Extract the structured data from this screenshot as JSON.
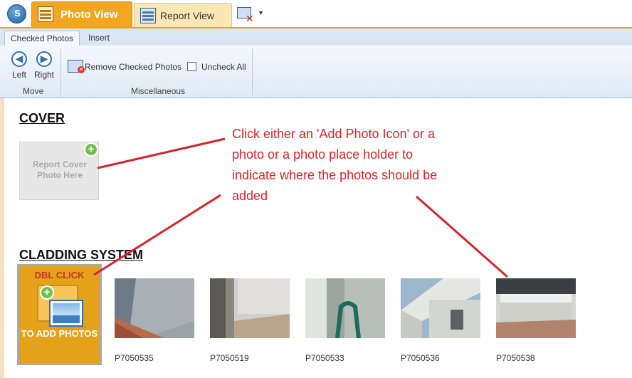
{
  "topbar": {
    "tabs": [
      {
        "label": "Photo View",
        "active": true
      },
      {
        "label": "Report View",
        "active": false
      }
    ]
  },
  "ribbon": {
    "tabs": [
      {
        "label": "Checked Photos",
        "active": true
      },
      {
        "label": "Insert",
        "active": false
      }
    ],
    "move_group": {
      "label": "Move",
      "left_label": "Left",
      "right_label": "Right"
    },
    "misc_group": {
      "label": "Miscellaneous",
      "remove_label": "Remove Checked Photos",
      "uncheck_label": "Uncheck All"
    }
  },
  "sections": {
    "cover": {
      "title": "COVER",
      "placeholder_text": "Report Cover Photo Here"
    },
    "cladding": {
      "title": "CLADDING SYSTEM",
      "add_tile_top": "DBL CLICK",
      "add_tile_bottom": "TO ADD PHOTOS",
      "photos": [
        {
          "name": "P7050535"
        },
        {
          "name": "P7050519"
        },
        {
          "name": "P7050533"
        },
        {
          "name": "P7050536"
        },
        {
          "name": "P7050538"
        }
      ]
    }
  },
  "annotation": {
    "text": "Click either an 'Add Photo Icon' or a photo or a photo place holder to indicate where the photos should be added",
    "color": "#d7232a"
  },
  "colors": {
    "accent": "#f2a51f",
    "ribbon": "#dbe6f4"
  }
}
